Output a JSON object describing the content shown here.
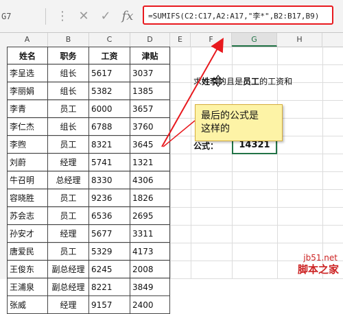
{
  "formula_bar": {
    "name_box": "G7",
    "cancel_icon": "close-icon",
    "enter_icon": "check-icon",
    "fx_label": "fx",
    "formula": "=SUMIFS(C2:C17,A2:A17,\"李*\",B2:B17,B9)"
  },
  "columns": [
    "A",
    "B",
    "C",
    "D",
    "E",
    "F",
    "G",
    "H"
  ],
  "table": {
    "headers": [
      "姓名",
      "职务",
      "工资",
      "津贴"
    ],
    "rows": [
      [
        "李呈选",
        "组长",
        "5617",
        "3037"
      ],
      [
        "李丽娟",
        "组长",
        "5382",
        "1385"
      ],
      [
        "李青",
        "员工",
        "6000",
        "3657"
      ],
      [
        "李仁杰",
        "组长",
        "6788",
        "3760"
      ],
      [
        "李煦",
        "员工",
        "8321",
        "3645"
      ],
      [
        "刘蔚",
        "经理",
        "5741",
        "1321"
      ],
      [
        "牛召明",
        "总经理",
        "8330",
        "4306"
      ],
      [
        "容晓胜",
        "员工",
        "9236",
        "1826"
      ],
      [
        "苏会志",
        "员工",
        "6536",
        "2695"
      ],
      [
        "孙安才",
        "经理",
        "5677",
        "3311"
      ],
      [
        "唐爱民",
        "员工",
        "5329",
        "4173"
      ],
      [
        "王俊东",
        "副总经理",
        "6245",
        "2008"
      ],
      [
        "王浦泉",
        "副总经理",
        "8221",
        "3849"
      ],
      [
        "张威",
        "经理",
        "9157",
        "2400"
      ]
    ]
  },
  "side": {
    "question_prefix": "求",
    "question_bold1": "姓李",
    "question_mid": "的且是",
    "question_bold2": "员工",
    "question_suffix": "的工资和",
    "formula_label": "公式：",
    "result": "14321"
  },
  "callout": {
    "line1": "最后的公式是",
    "line2": "这样的"
  },
  "watermark": {
    "site": "jb51.net",
    "name": "脚本之家"
  },
  "colors": {
    "excel_green": "#217346",
    "highlight_red": "#e8191e",
    "callout_bg": "#fdf3a6"
  }
}
